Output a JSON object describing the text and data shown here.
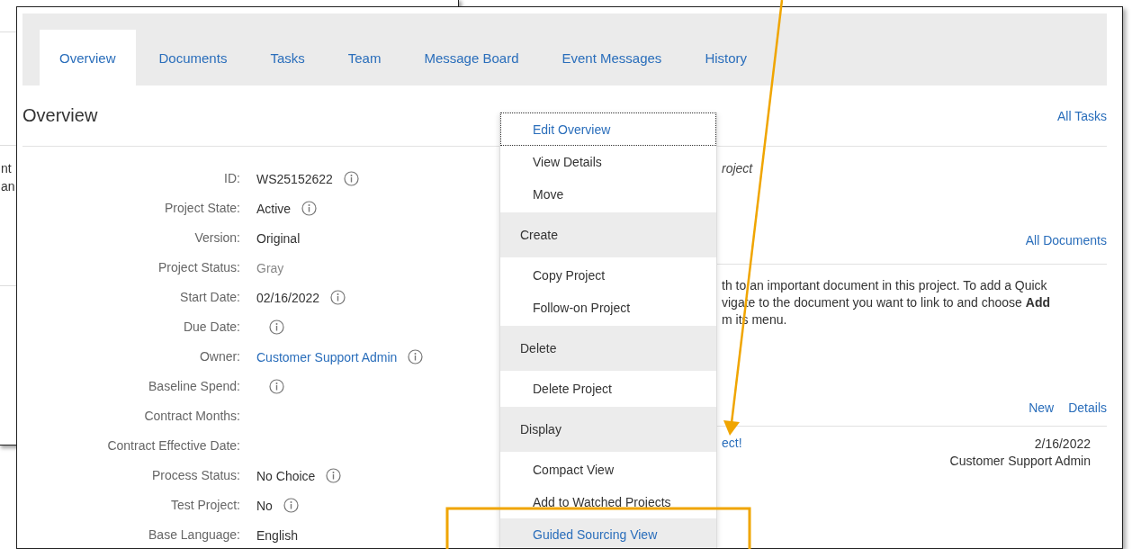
{
  "background_window": {
    "texts": [
      "nt",
      "an"
    ]
  },
  "tabs": [
    {
      "label": "Overview",
      "selected": true
    },
    {
      "label": "Documents",
      "selected": false
    },
    {
      "label": "Tasks",
      "selected": false
    },
    {
      "label": "Team",
      "selected": false
    },
    {
      "label": "Message Board",
      "selected": false
    },
    {
      "label": "Event Messages",
      "selected": false
    },
    {
      "label": "History",
      "selected": false
    }
  ],
  "overview": {
    "title": "Overview",
    "fields": [
      {
        "label": "ID:",
        "value": "WS25152622",
        "kind": "text",
        "info": true
      },
      {
        "label": "Project State:",
        "value": "Active",
        "kind": "text",
        "info": true
      },
      {
        "label": "Version:",
        "value": "Original",
        "kind": "text",
        "info": false
      },
      {
        "label": "Project Status:",
        "value": "Gray",
        "kind": "muted",
        "info": false
      },
      {
        "label": "Start Date:",
        "value": "02/16/2022",
        "kind": "text",
        "info": true
      },
      {
        "label": "Due Date:",
        "kind": "text",
        "info": true
      },
      {
        "label": "Owner:",
        "value": "Customer Support Admin",
        "kind": "link",
        "info": true
      },
      {
        "label": "Baseline Spend:",
        "kind": "text",
        "info": true
      },
      {
        "label": "Contract Months:",
        "kind": "text",
        "info": false
      },
      {
        "label": "Contract Effective Date:",
        "kind": "text",
        "info": false
      },
      {
        "label": "Process Status:",
        "value": "No Choice",
        "kind": "text",
        "info": true
      },
      {
        "label": "Test Project:",
        "value": "No",
        "kind": "text",
        "info": true
      },
      {
        "label": "Base Language:",
        "value": "English",
        "kind": "text",
        "info": false
      }
    ]
  },
  "menu": {
    "items": [
      {
        "kind": "item",
        "label": "Edit Overview",
        "focused": true,
        "selected": false
      },
      {
        "kind": "item",
        "label": "View Details",
        "focused": false,
        "selected": false
      },
      {
        "kind": "item",
        "label": "Move",
        "focused": false,
        "selected": false
      },
      {
        "kind": "header",
        "label": "Create"
      },
      {
        "kind": "item",
        "label": "Copy Project",
        "focused": false,
        "selected": false
      },
      {
        "kind": "item",
        "label": "Follow-on Project",
        "focused": false,
        "selected": false
      },
      {
        "kind": "header",
        "label": "Delete"
      },
      {
        "kind": "item",
        "label": "Delete Project",
        "focused": false,
        "selected": false
      },
      {
        "kind": "header",
        "label": "Display"
      },
      {
        "kind": "item",
        "label": "Compact View",
        "focused": false,
        "selected": false
      },
      {
        "kind": "item",
        "label": "Add to Watched Projects",
        "focused": false,
        "selected": false
      },
      {
        "kind": "item",
        "label": "Guided Sourcing View",
        "focused": false,
        "selected": true
      }
    ]
  },
  "tasks": {
    "link": "All Tasks",
    "fragment": "roject"
  },
  "documents": {
    "link": "All Documents",
    "lines": [
      "th to an important document in this project. To add a Quick",
      "vigate to the document you want to link to and choose **Add**",
      "m its menu."
    ]
  },
  "messages": {
    "links": [
      "New",
      "Details"
    ],
    "entries": [
      {
        "title": "ect!",
        "date": "2/16/2022",
        "author": "Customer Support Admin"
      }
    ]
  }
}
